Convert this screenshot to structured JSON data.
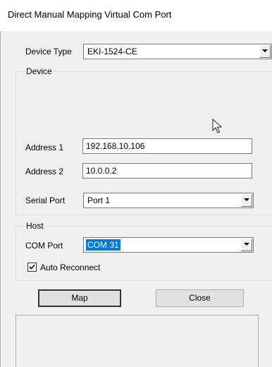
{
  "window": {
    "title": "Direct Manual Mapping Virtual Com Port"
  },
  "device_type": {
    "label": "Device Type",
    "value": "EKI-1524-CE"
  },
  "device_group": {
    "legend": "Device",
    "address1": {
      "label": "Address 1",
      "value": "192.168.10.106"
    },
    "address2": {
      "label": "Address 2",
      "value": "10.0.0.2"
    },
    "serial_port": {
      "label": "Serial Port",
      "value": "Port 1"
    }
  },
  "host_group": {
    "legend": "Host",
    "com_port": {
      "label": "COM Port",
      "value": "COM 31"
    },
    "auto_reconnect": {
      "label": "Auto Reconnect",
      "checked": true
    }
  },
  "buttons": {
    "map": "Map",
    "close": "Close"
  },
  "icons": {
    "dropdown": "chevron-down-icon",
    "checkmark": "checkmark-icon",
    "cursor": "mouse-pointer-icon"
  },
  "colors": {
    "selection": "#0078d7",
    "window_bg": "#f0f0f0"
  }
}
